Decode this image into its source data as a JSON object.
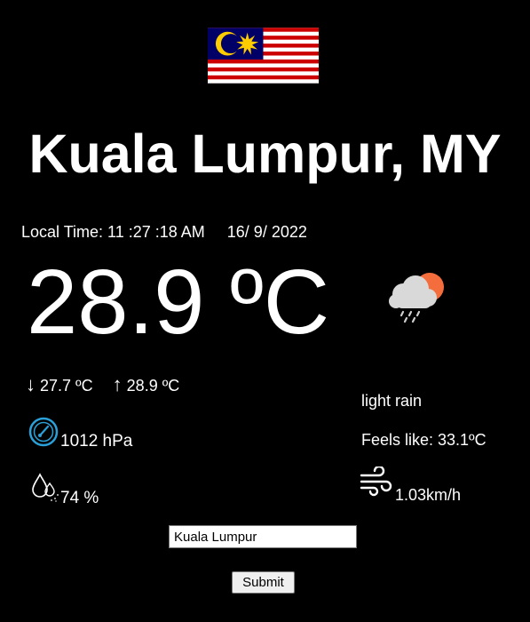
{
  "location": {
    "city": "Kuala Lumpur, MY",
    "flag_icon": "malaysia-flag"
  },
  "time": {
    "label": "Local Time: 11 :27 :18 AM     16/ 9/ 2022"
  },
  "current": {
    "temperature": "28.9 ºC",
    "condition_icon": "cloud-rain-sun-icon",
    "description": "light rain",
    "feels_like": "Feels like: 33.1ºC"
  },
  "range": {
    "min_arrow": "↓",
    "min": "27.7 ºC",
    "max_arrow": "↑",
    "max": "28.9 ºC"
  },
  "details": {
    "pressure": "1012 hPa",
    "pressure_icon": "gauge-icon",
    "humidity": "74 %",
    "humidity_icon": "humidity-drop-icon",
    "wind": "1.03km/h",
    "wind_icon": "wind-icon"
  },
  "search": {
    "value": "Kuala Lumpur",
    "submit_label": "Submit"
  },
  "colors": {
    "background": "#000000",
    "text": "#ffffff",
    "gauge_accent": "#2a9fd8"
  }
}
